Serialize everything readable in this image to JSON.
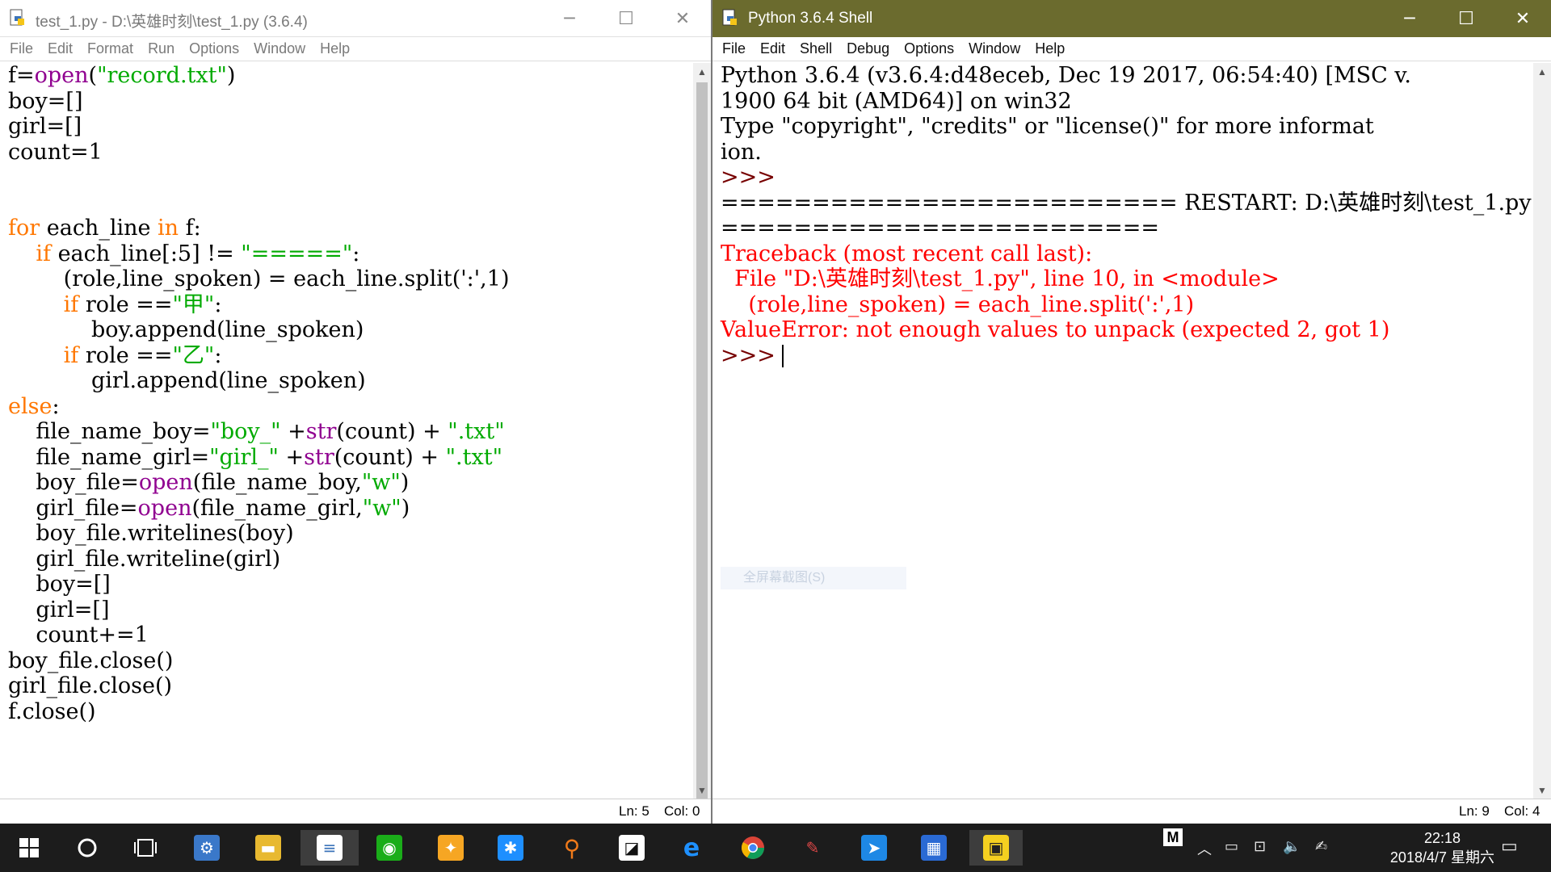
{
  "editor": {
    "title": "test_1.py - D:\\英雄时刻\\test_1.py (3.6.4)",
    "menu": [
      "File",
      "Edit",
      "Format",
      "Run",
      "Options",
      "Window",
      "Help"
    ],
    "status_ln": "Ln: 5",
    "status_col": "Col: 0"
  },
  "shell": {
    "title": "Python 3.6.4 Shell",
    "menu": [
      "File",
      "Edit",
      "Shell",
      "Debug",
      "Options",
      "Window",
      "Help"
    ],
    "status_ln": "Ln: 9",
    "status_col": "Col: 4",
    "ghost_text": "全屏幕截图(S)"
  },
  "window_controls": {
    "minimize": "─",
    "maximize": "☐",
    "close": "✕"
  },
  "taskbar": {
    "time": "22:18",
    "date": "2018/4/7 星期六",
    "ime": "M",
    "apps": [
      "start-icon",
      "cortana-icon",
      "task-view-icon",
      "control-panel-icon",
      "file-explorer-icon",
      "idle-icon",
      "wechat-icon",
      "app-orange-icon",
      "dingtalk-icon",
      "search-app-icon",
      "sticky-notes-icon",
      "edge-icon",
      "chrome-icon",
      "paint-icon",
      "feishu-icon",
      "calculator-icon",
      "python-shell-icon"
    ]
  },
  "colors": {
    "keyword": "#ff7700",
    "builtin": "#900090",
    "string": "#00aa00",
    "error": "#ff0000",
    "shell_title": "#6b6b2e",
    "taskbar": "#1c1c1c"
  }
}
